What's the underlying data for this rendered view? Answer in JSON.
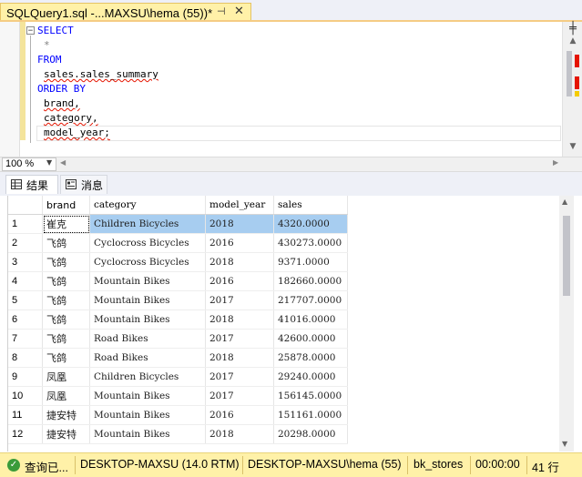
{
  "tab": {
    "title": "SQLQuery1.sql -...MAXSU\\hema (55))*",
    "pin": "⊣",
    "close": "✕"
  },
  "editor": {
    "collapse": "−",
    "lines": [
      "SELECT",
      "*",
      "FROM",
      "sales.sales_summary",
      "ORDER BY",
      "brand,",
      "category,",
      "model_year;"
    ],
    "split": "╪"
  },
  "zoom": {
    "value": "100 %"
  },
  "results_tabs": {
    "results": "结果",
    "messages": "消息"
  },
  "grid": {
    "columns": [
      "brand",
      "category",
      "model_year",
      "sales"
    ],
    "rows": [
      [
        "1",
        "崔克",
        "Children Bicycles",
        "2018",
        "4320.0000"
      ],
      [
        "2",
        "飞鸽",
        "Cyclocross Bicycles",
        "2016",
        "430273.0000"
      ],
      [
        "3",
        "飞鸽",
        "Cyclocross Bicycles",
        "2018",
        "9371.0000"
      ],
      [
        "4",
        "飞鸽",
        "Mountain Bikes",
        "2016",
        "182660.0000"
      ],
      [
        "5",
        "飞鸽",
        "Mountain Bikes",
        "2017",
        "217707.0000"
      ],
      [
        "6",
        "飞鸽",
        "Mountain Bikes",
        "2018",
        "41016.0000"
      ],
      [
        "7",
        "飞鸽",
        "Road Bikes",
        "2017",
        "42600.0000"
      ],
      [
        "8",
        "飞鸽",
        "Road Bikes",
        "2018",
        "25878.0000"
      ],
      [
        "9",
        "凤凰",
        "Children Bicycles",
        "2017",
        "29240.0000"
      ],
      [
        "10",
        "凤凰",
        "Mountain Bikes",
        "2017",
        "156145.0000"
      ],
      [
        "11",
        "捷安特",
        "Mountain Bikes",
        "2016",
        "151161.0000"
      ],
      [
        "12",
        "捷安特",
        "Mountain Bikes",
        "2018",
        "20298.0000"
      ]
    ]
  },
  "status": {
    "query_state": "查询已...",
    "server": "DESKTOP-MAXSU (14.0 RTM)",
    "login": "DESKTOP-MAXSU\\hema (55)",
    "database": "bk_stores",
    "elapsed": "00:00:00",
    "row_count": "41 行"
  },
  "colors": {
    "accent_yellow": "#fff1a8",
    "selection": "#a7cdf0",
    "keyword": "#0000ff",
    "error_squiggle": "#e51400"
  }
}
